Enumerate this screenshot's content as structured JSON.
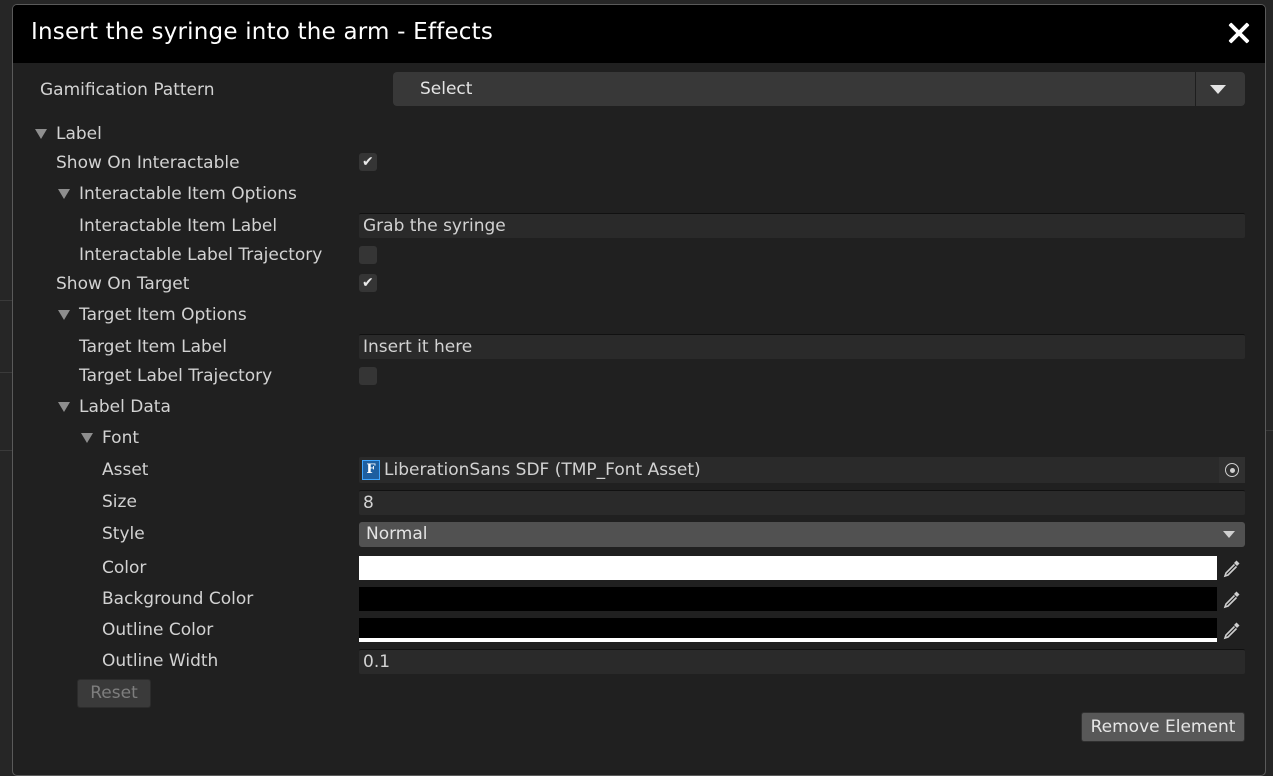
{
  "dialog": {
    "title": "Insert the syringe into the arm - Effects"
  },
  "gamification": {
    "label": "Gamification Pattern",
    "selected": "Select"
  },
  "label_section": {
    "header": "Label",
    "show_on_interactable": {
      "label": "Show On Interactable",
      "checked": true
    },
    "interactable_options": {
      "header": "Interactable Item Options",
      "item_label": {
        "label": "Interactable Item Label",
        "value": "Grab the syringe"
      },
      "trajectory": {
        "label": "Interactable Label Trajectory",
        "checked": false
      }
    },
    "show_on_target": {
      "label": "Show On Target",
      "checked": true
    },
    "target_options": {
      "header": "Target Item Options",
      "item_label": {
        "label": "Target Item Label",
        "value": "Insert it here"
      },
      "trajectory": {
        "label": "Target Label Trajectory",
        "checked": false
      }
    },
    "label_data": {
      "header": "Label Data",
      "font": {
        "header": "Font",
        "asset": {
          "label": "Asset",
          "value": "LiberationSans SDF (TMP_Font Asset)",
          "icon_letter": "F"
        },
        "size": {
          "label": "Size",
          "value": "8"
        },
        "style": {
          "label": "Style",
          "value": "Normal"
        },
        "color": {
          "label": "Color",
          "value": "#ffffff"
        },
        "background_color": {
          "label": "Background Color",
          "value": "#000000"
        },
        "outline_color": {
          "label": "Outline Color",
          "value": "#000000"
        },
        "outline_width": {
          "label": "Outline Width",
          "value": "0.1"
        }
      }
    },
    "reset_label": "Reset"
  },
  "remove_label": "Remove Element",
  "check_glyph": "✔"
}
